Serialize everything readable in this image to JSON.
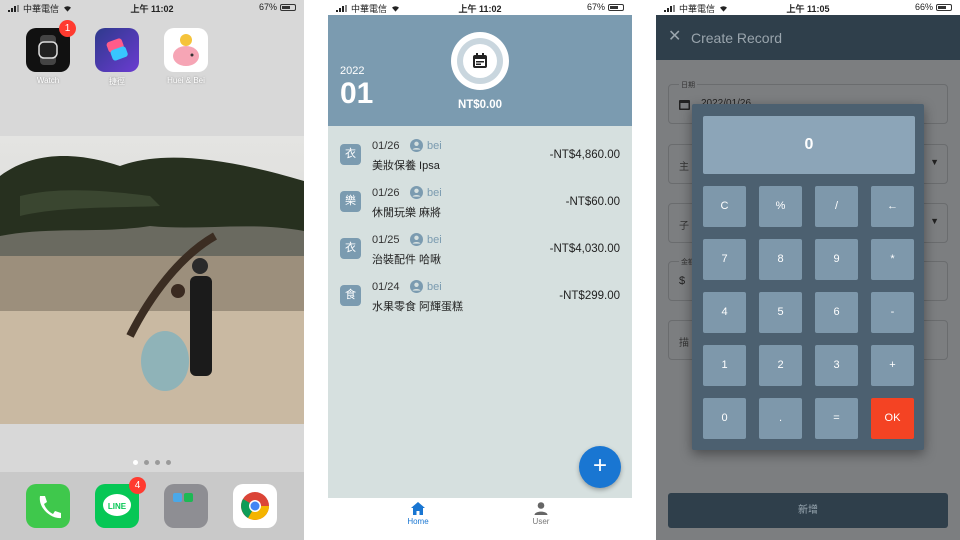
{
  "panel_home_screen": {
    "status": {
      "carrier": "中華電信",
      "time": "上午 11:02",
      "battery": "67%",
      "battery_level": 0.67
    },
    "apps": [
      {
        "label": "Watch",
        "icon": "watch-app-icon",
        "badge": "1"
      },
      {
        "label": "捷徑",
        "icon": "shortcuts-app-icon",
        "badge": ""
      },
      {
        "label": "Huei & Bei",
        "icon": "piggy-bank-app-icon",
        "badge": ""
      }
    ],
    "page_dots": 4,
    "active_dot": 1,
    "dock": [
      {
        "icon": "phone-app-icon",
        "badge": ""
      },
      {
        "icon": "line-app-icon",
        "label": "LINE",
        "badge": "4"
      },
      {
        "icon": "folder-app-icon",
        "badge": ""
      },
      {
        "icon": "chrome-app-icon",
        "badge": ""
      }
    ]
  },
  "panel_app_home": {
    "status": {
      "carrier": "中華電信",
      "time": "上午 11:02",
      "battery": "67%",
      "battery_level": 0.67
    },
    "year": "2022",
    "month": "01",
    "total": "NT$0.00",
    "records": [
      {
        "category": "衣",
        "date": "01/26",
        "user": "bei",
        "description": "美妝保養 Ipsa",
        "amount": "-NT$4,860.00"
      },
      {
        "category": "樂",
        "date": "01/26",
        "user": "bei",
        "description": "休閒玩樂 麻將",
        "amount": "-NT$60.00"
      },
      {
        "category": "衣",
        "date": "01/25",
        "user": "bei",
        "description": "治裝配件 哈啾",
        "amount": "-NT$4,030.00"
      },
      {
        "category": "食",
        "date": "01/24",
        "user": "bei",
        "description": "水果零食 阿輝蛋糕",
        "amount": "-NT$299.00"
      }
    ],
    "fab_label": "+",
    "nav": [
      {
        "label": "Home",
        "icon": "home-icon",
        "active": true
      },
      {
        "label": "User",
        "icon": "user-icon",
        "active": false
      }
    ],
    "colors": {
      "header": "#7b9bb0",
      "accent": "#1976d2",
      "background": "#d6e0df"
    }
  },
  "panel_create_record": {
    "status": {
      "carrier": "中華電信",
      "time": "上午 11:05",
      "battery": "66%",
      "battery_level": 0.66
    },
    "title": "Create Record",
    "date_label": "日期",
    "date_value": "2022/01/26",
    "main_category_label": "主",
    "sub_category_label": "子",
    "amount_label": "金額",
    "amount_prefix": "$",
    "description_label": "描",
    "display": "0",
    "keys": [
      "C",
      "%",
      "/",
      "←",
      "7",
      "8",
      "9",
      "*",
      "4",
      "5",
      "6",
      "-",
      "1",
      "2",
      "3",
      "+",
      "0",
      ".",
      "=",
      "OK"
    ],
    "submit": "新增",
    "colors": {
      "ok": "#f44323",
      "calculator": "#4c6070",
      "key": "#7e98ab"
    }
  }
}
